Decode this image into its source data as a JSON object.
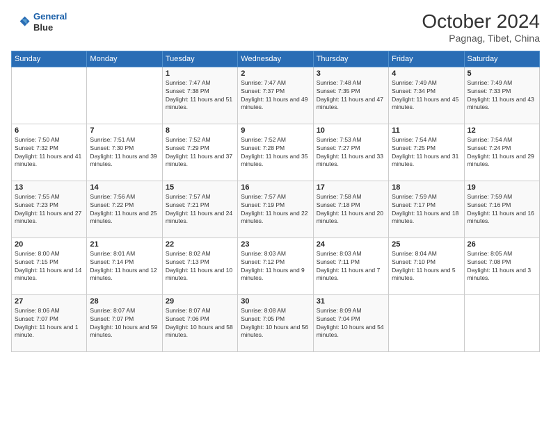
{
  "header": {
    "logo_line1": "General",
    "logo_line2": "Blue",
    "month": "October 2024",
    "location": "Pagnag, Tibet, China"
  },
  "weekdays": [
    "Sunday",
    "Monday",
    "Tuesday",
    "Wednesday",
    "Thursday",
    "Friday",
    "Saturday"
  ],
  "weeks": [
    [
      {
        "day": "",
        "info": ""
      },
      {
        "day": "",
        "info": ""
      },
      {
        "day": "1",
        "info": "Sunrise: 7:47 AM\nSunset: 7:38 PM\nDaylight: 11 hours and 51 minutes."
      },
      {
        "day": "2",
        "info": "Sunrise: 7:47 AM\nSunset: 7:37 PM\nDaylight: 11 hours and 49 minutes."
      },
      {
        "day": "3",
        "info": "Sunrise: 7:48 AM\nSunset: 7:35 PM\nDaylight: 11 hours and 47 minutes."
      },
      {
        "day": "4",
        "info": "Sunrise: 7:49 AM\nSunset: 7:34 PM\nDaylight: 11 hours and 45 minutes."
      },
      {
        "day": "5",
        "info": "Sunrise: 7:49 AM\nSunset: 7:33 PM\nDaylight: 11 hours and 43 minutes."
      }
    ],
    [
      {
        "day": "6",
        "info": "Sunrise: 7:50 AM\nSunset: 7:32 PM\nDaylight: 11 hours and 41 minutes."
      },
      {
        "day": "7",
        "info": "Sunrise: 7:51 AM\nSunset: 7:30 PM\nDaylight: 11 hours and 39 minutes."
      },
      {
        "day": "8",
        "info": "Sunrise: 7:52 AM\nSunset: 7:29 PM\nDaylight: 11 hours and 37 minutes."
      },
      {
        "day": "9",
        "info": "Sunrise: 7:52 AM\nSunset: 7:28 PM\nDaylight: 11 hours and 35 minutes."
      },
      {
        "day": "10",
        "info": "Sunrise: 7:53 AM\nSunset: 7:27 PM\nDaylight: 11 hours and 33 minutes."
      },
      {
        "day": "11",
        "info": "Sunrise: 7:54 AM\nSunset: 7:25 PM\nDaylight: 11 hours and 31 minutes."
      },
      {
        "day": "12",
        "info": "Sunrise: 7:54 AM\nSunset: 7:24 PM\nDaylight: 11 hours and 29 minutes."
      }
    ],
    [
      {
        "day": "13",
        "info": "Sunrise: 7:55 AM\nSunset: 7:23 PM\nDaylight: 11 hours and 27 minutes."
      },
      {
        "day": "14",
        "info": "Sunrise: 7:56 AM\nSunset: 7:22 PM\nDaylight: 11 hours and 25 minutes."
      },
      {
        "day": "15",
        "info": "Sunrise: 7:57 AM\nSunset: 7:21 PM\nDaylight: 11 hours and 24 minutes."
      },
      {
        "day": "16",
        "info": "Sunrise: 7:57 AM\nSunset: 7:19 PM\nDaylight: 11 hours and 22 minutes."
      },
      {
        "day": "17",
        "info": "Sunrise: 7:58 AM\nSunset: 7:18 PM\nDaylight: 11 hours and 20 minutes."
      },
      {
        "day": "18",
        "info": "Sunrise: 7:59 AM\nSunset: 7:17 PM\nDaylight: 11 hours and 18 minutes."
      },
      {
        "day": "19",
        "info": "Sunrise: 7:59 AM\nSunset: 7:16 PM\nDaylight: 11 hours and 16 minutes."
      }
    ],
    [
      {
        "day": "20",
        "info": "Sunrise: 8:00 AM\nSunset: 7:15 PM\nDaylight: 11 hours and 14 minutes."
      },
      {
        "day": "21",
        "info": "Sunrise: 8:01 AM\nSunset: 7:14 PM\nDaylight: 11 hours and 12 minutes."
      },
      {
        "day": "22",
        "info": "Sunrise: 8:02 AM\nSunset: 7:13 PM\nDaylight: 11 hours and 10 minutes."
      },
      {
        "day": "23",
        "info": "Sunrise: 8:03 AM\nSunset: 7:12 PM\nDaylight: 11 hours and 9 minutes."
      },
      {
        "day": "24",
        "info": "Sunrise: 8:03 AM\nSunset: 7:11 PM\nDaylight: 11 hours and 7 minutes."
      },
      {
        "day": "25",
        "info": "Sunrise: 8:04 AM\nSunset: 7:10 PM\nDaylight: 11 hours and 5 minutes."
      },
      {
        "day": "26",
        "info": "Sunrise: 8:05 AM\nSunset: 7:08 PM\nDaylight: 11 hours and 3 minutes."
      }
    ],
    [
      {
        "day": "27",
        "info": "Sunrise: 8:06 AM\nSunset: 7:07 PM\nDaylight: 11 hours and 1 minute."
      },
      {
        "day": "28",
        "info": "Sunrise: 8:07 AM\nSunset: 7:07 PM\nDaylight: 10 hours and 59 minutes."
      },
      {
        "day": "29",
        "info": "Sunrise: 8:07 AM\nSunset: 7:06 PM\nDaylight: 10 hours and 58 minutes."
      },
      {
        "day": "30",
        "info": "Sunrise: 8:08 AM\nSunset: 7:05 PM\nDaylight: 10 hours and 56 minutes."
      },
      {
        "day": "31",
        "info": "Sunrise: 8:09 AM\nSunset: 7:04 PM\nDaylight: 10 hours and 54 minutes."
      },
      {
        "day": "",
        "info": ""
      },
      {
        "day": "",
        "info": ""
      }
    ]
  ]
}
